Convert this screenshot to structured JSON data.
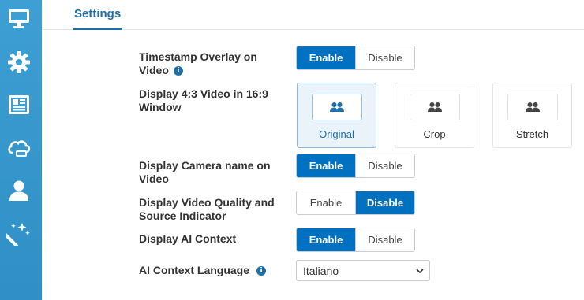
{
  "sidebar": {
    "items": [
      {
        "icon": "monitor-icon"
      },
      {
        "icon": "gear-icon"
      },
      {
        "icon": "news-panel-icon"
      },
      {
        "icon": "cloud-sync-icon"
      },
      {
        "icon": "user-icon"
      },
      {
        "icon": "magic-wand-icon"
      }
    ]
  },
  "tabs": {
    "settings": "Settings"
  },
  "settings": {
    "timestamp_overlay": {
      "label": "Timestamp Overlay on Video",
      "enable": "Enable",
      "disable": "Disable",
      "selected": "Enable"
    },
    "display_43": {
      "label": "Display 4:3 Video in 16:9 Window",
      "options": [
        {
          "label": "Original",
          "selected": true
        },
        {
          "label": "Crop",
          "selected": false
        },
        {
          "label": "Stretch",
          "selected": false
        }
      ]
    },
    "camera_name": {
      "label": "Display Camera name on Video",
      "enable": "Enable",
      "disable": "Disable",
      "selected": "Enable"
    },
    "video_quality": {
      "label": "Display Video Quality and Source Indicator",
      "enable": "Enable",
      "disable": "Disable",
      "selected": "Disable"
    },
    "ai_context": {
      "label": "Display AI Context",
      "enable": "Enable",
      "disable": "Disable",
      "selected": "Enable"
    },
    "ai_language": {
      "label": "AI Context Language",
      "value": "Italiano"
    }
  },
  "colors": {
    "accent": "#0070c0",
    "sidebar": "#3d9fd3",
    "tab": "#1f6fab"
  }
}
